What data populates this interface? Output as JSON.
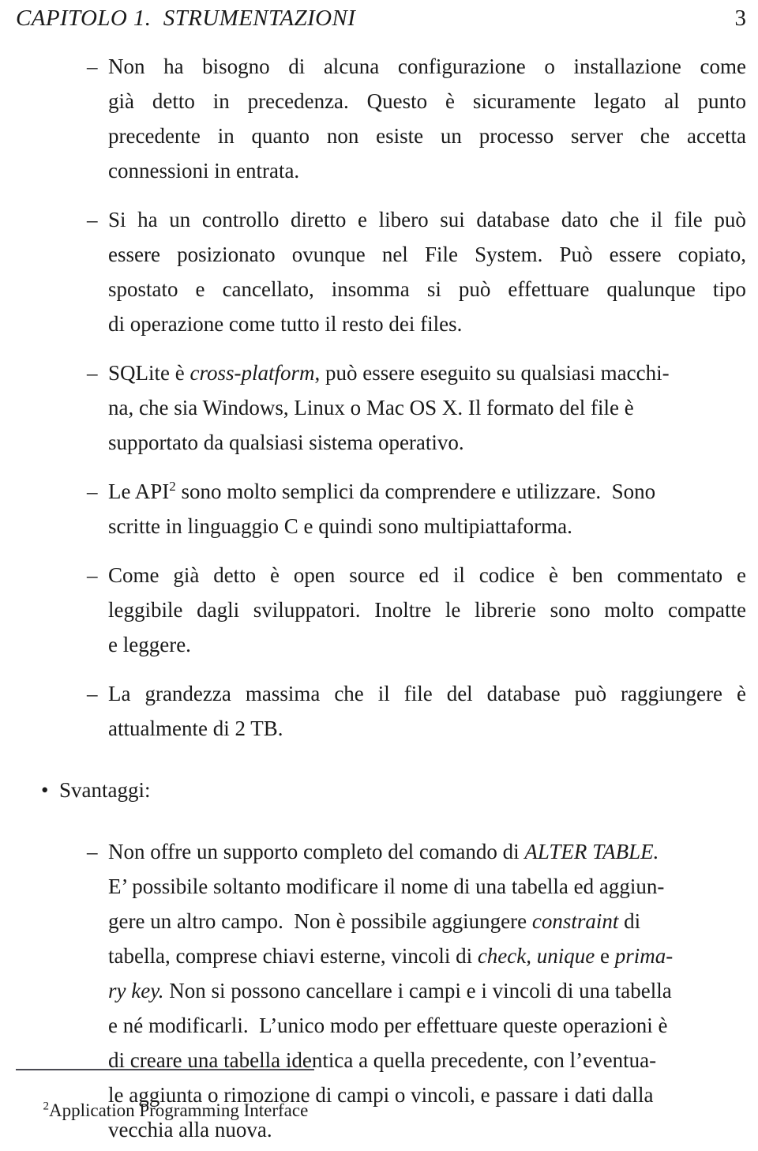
{
  "header": {
    "title": "CAPITOLO 1.  STRUMENTAZIONI",
    "page_number": "3"
  },
  "markers": {
    "bullet": "•",
    "dash": "–"
  },
  "content": {
    "advantages_items": [
      {
        "id": "no-config",
        "lines": [
          [
            "Non",
            "ha",
            "bisogno",
            "di",
            "alcuna",
            "configurazione",
            "o",
            "installazione",
            "come"
          ],
          [
            "già",
            "detto",
            "in",
            "precedenza.",
            "Questo",
            "è",
            "sicuramente",
            "legato",
            "al",
            "punto"
          ],
          [
            "precedente",
            "in",
            "quanto",
            "non",
            "esiste",
            "un",
            "processo",
            "server",
            "che",
            "accetta"
          ],
          [
            "connessioni in entrata."
          ]
        ]
      },
      {
        "id": "direct-control",
        "lines": [
          [
            "Si",
            "ha",
            "un",
            "controllo",
            "diretto",
            "e",
            "libero",
            "sui",
            "database",
            "dato",
            "che",
            "il",
            "file",
            "può"
          ],
          [
            "essere",
            "posizionato",
            "ovunque",
            "nel",
            "File",
            "System.",
            "Può",
            "essere",
            "copiato,"
          ],
          [
            "spostato",
            "e",
            "cancellato,",
            "insomma",
            "si",
            "può",
            "effettuare",
            "qualunque",
            "tipo"
          ],
          [
            "di operazione come tutto il resto dei files."
          ]
        ]
      },
      {
        "id": "cross-platform",
        "lines_rich": [
          [
            {
              "t": "SQLite è "
            },
            {
              "t": "cross-platform",
              "i": true
            },
            {
              "t": ", può essere eseguito su qualsiasi macchi-"
            }
          ],
          [
            {
              "t": "na, che sia Windows, Linux o Mac OS X. Il formato del file è"
            }
          ],
          [
            {
              "t": "supportato da qualsiasi sistema operativo."
            }
          ]
        ]
      },
      {
        "id": "simple-api",
        "lines_rich": [
          [
            {
              "t": "Le API"
            },
            {
              "t": "2",
              "sup": true
            },
            {
              "t": " sono molto semplici da comprendere e utilizzare.  Sono"
            }
          ],
          [
            {
              "t": "scritte in linguaggio C e quindi sono multipiattaforma."
            }
          ]
        ]
      },
      {
        "id": "open-source",
        "lines": [
          [
            "Come",
            "già",
            "detto",
            "è",
            "open",
            "source",
            "ed",
            "il",
            "codice",
            "è",
            "ben",
            "commentato",
            "e"
          ],
          [
            "leggibile",
            "dagli",
            "sviluppatori.",
            "Inoltre",
            "le",
            "librerie",
            "sono",
            "molto",
            "compatte"
          ],
          [
            "e leggere."
          ]
        ]
      },
      {
        "id": "max-size",
        "lines": [
          [
            "La",
            "grandezza",
            "massima",
            "che",
            "il",
            "file",
            "del",
            "database",
            "può",
            "raggiungere",
            "è"
          ],
          [
            "attualmente di 2 TB."
          ]
        ]
      }
    ],
    "disadvantages_heading": "Svantaggi:",
    "disadvantages_items": [
      {
        "id": "alter-table",
        "lines_rich": [
          [
            {
              "t": "Non offre un supporto completo del comando di "
            },
            {
              "t": "ALTER TABLE.",
              "i": true
            }
          ],
          [
            {
              "t": "E’ possibile soltanto modificare il nome di una tabella ed aggiun-"
            }
          ],
          [
            {
              "t": "gere un altro campo.  Non è possibile aggiungere "
            },
            {
              "t": "constraint",
              "i": true
            },
            {
              "t": " di"
            }
          ],
          [
            {
              "t": "tabella, comprese chiavi esterne, vincoli di "
            },
            {
              "t": "check,",
              "i": true
            },
            {
              "t": " "
            },
            {
              "t": "unique",
              "i": true
            },
            {
              "t": " e "
            },
            {
              "t": "prima-",
              "i": true
            }
          ],
          [
            {
              "t": "ry key.",
              "i": true
            },
            {
              "t": " Non si possono cancellare i campi e i vincoli di una tabella"
            }
          ],
          [
            {
              "t": "e né modificarli.  L’unico modo per effettuare queste operazioni è"
            }
          ],
          [
            {
              "t": "di creare una tabella identica a quella precedente, con l’eventua-"
            }
          ],
          [
            {
              "t": "le aggiunta o rimozione di campi o vincoli, e passare i dati dalla"
            }
          ],
          [
            {
              "t": "vecchia alla nuova."
            }
          ]
        ]
      }
    ]
  },
  "footnote": {
    "marker": "2",
    "text": "Application Programming Interface"
  }
}
